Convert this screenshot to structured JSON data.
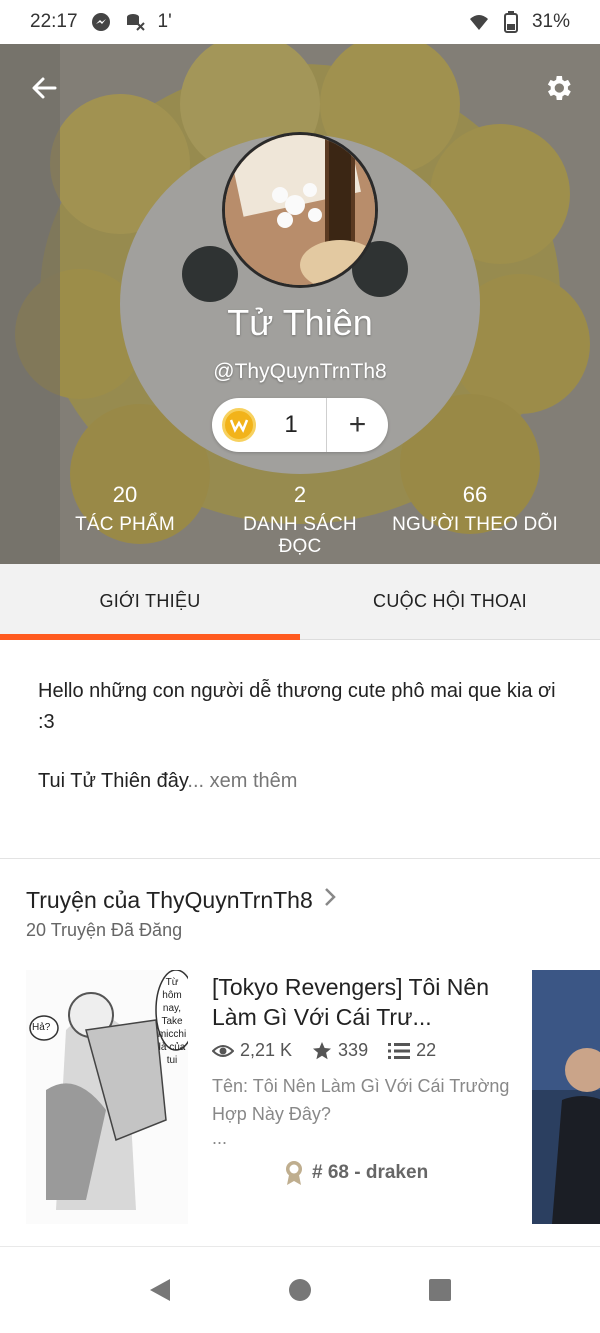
{
  "status_bar": {
    "time": "22:17",
    "extra": "1'",
    "battery": "31%"
  },
  "profile": {
    "display_name": "Tử Thiên",
    "username": "@ThyQuynTrnTh8",
    "coins": "1",
    "add_symbol": "+"
  },
  "stats": [
    {
      "value": "20",
      "label": "TÁC PHẨM"
    },
    {
      "value": "2",
      "label": "DANH SÁCH ĐỌC"
    },
    {
      "value": "66",
      "label": "NGƯỜI THEO DÕI"
    }
  ],
  "tabs": [
    {
      "label": "GIỚI THIỆU",
      "active": true
    },
    {
      "label": "CUỘC HỘI THOẠI",
      "active": false
    }
  ],
  "about": {
    "line1": "Hello những con người dễ thương cute phô mai que kia ơi :3",
    "line2": "Tui Tử Thiên đây",
    "ellipsis": "...",
    "more": " xem thêm"
  },
  "stories_section": {
    "title": "Truyện của ThyQuynTrnTh8",
    "subtitle": "20 Truyện Đã Đăng"
  },
  "story": {
    "title": "[Tokyo Revengers] Tôi Nên Làm Gì Với Cái Trư...",
    "views": "2,21 K",
    "votes": "339",
    "parts": "22",
    "description": "Tên: Tôi Nên Làm Gì Với Cái Trường Hợp Này Đây?",
    "ellipsis": "...",
    "rank": "# 68 - draken",
    "cover_bubbles": [
      "Hả?",
      "Từ hôm nay, Take micchi là của tui"
    ]
  },
  "colors": {
    "accent": "#ff5a1f",
    "coin": "#f2b31a"
  }
}
